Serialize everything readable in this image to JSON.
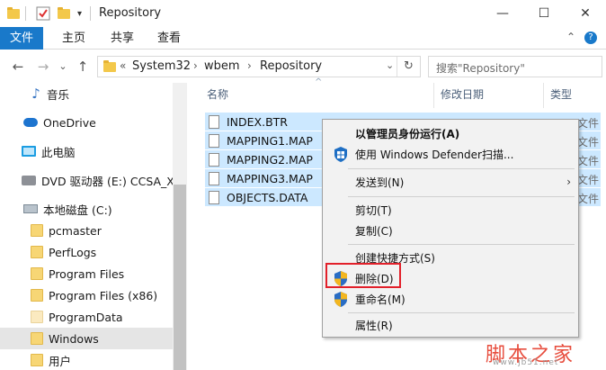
{
  "window": {
    "title": "Repository",
    "minimize": "—",
    "maximize": "☐",
    "close": "✕"
  },
  "ribbon": {
    "tabs": [
      "文件",
      "主页",
      "共享",
      "查看"
    ],
    "help_chevron": "⌃"
  },
  "address": {
    "back": "←",
    "forward": "→",
    "recent": "⌄",
    "up": "↑",
    "overflow": "«",
    "crumbs": [
      "System32",
      "wbem",
      "Repository"
    ],
    "separator": "›",
    "dropdown": "⌄",
    "refresh": "↻",
    "search_placeholder": "搜索\"Repository\""
  },
  "nav": {
    "items": [
      {
        "label": "音乐",
        "icon": "music-icon"
      },
      {
        "label": "OneDrive",
        "icon": "onedrive-icon"
      },
      {
        "label": "此电脑",
        "icon": "computer-icon"
      },
      {
        "label": "DVD 驱动器 (E:) CCSA_X64",
        "icon": "dvd-drive-icon"
      },
      {
        "label": "本地磁盘 (C:)",
        "icon": "local-disk-icon"
      },
      {
        "label": "pcmaster",
        "icon": "folder-icon"
      },
      {
        "label": "PerfLogs",
        "icon": "folder-icon"
      },
      {
        "label": "Program Files",
        "icon": "folder-icon"
      },
      {
        "label": "Program Files (x86)",
        "icon": "folder-icon"
      },
      {
        "label": "ProgramData",
        "icon": "folder-icon"
      },
      {
        "label": "Windows",
        "icon": "folder-icon",
        "selected": true
      },
      {
        "label": "用户",
        "icon": "folder-icon"
      }
    ]
  },
  "columns": {
    "name": "名称",
    "date": "修改日期",
    "type": "类型"
  },
  "files": [
    {
      "name": "INDEX.BTR",
      "type_peek": "文件"
    },
    {
      "name": "MAPPING1.MAP",
      "type_peek": "文件"
    },
    {
      "name": "MAPPING2.MAP",
      "type_peek": "文件"
    },
    {
      "name": "MAPPING3.MAP",
      "type_peek": "文件"
    },
    {
      "name": "OBJECTS.DATA",
      "type_peek": "文件"
    }
  ],
  "context_menu": {
    "run_as_admin": "以管理员身份运行(A)",
    "defender_scan": "使用 Windows Defender扫描...",
    "send_to": "发送到(N)",
    "cut": "剪切(T)",
    "copy": "复制(C)",
    "create_shortcut": "创建快捷方式(S)",
    "delete": "删除(D)",
    "rename": "重命名(M)",
    "properties": "属性(R)",
    "submenu_arrow": "›"
  },
  "watermark": {
    "brand": "脚本之家",
    "url": "www.jb51.net"
  },
  "colors": {
    "file_tab": "#1979ca",
    "selection": "#cce8ff",
    "delete_highlight": "#e2202a",
    "watermark": "#e74c3c"
  }
}
